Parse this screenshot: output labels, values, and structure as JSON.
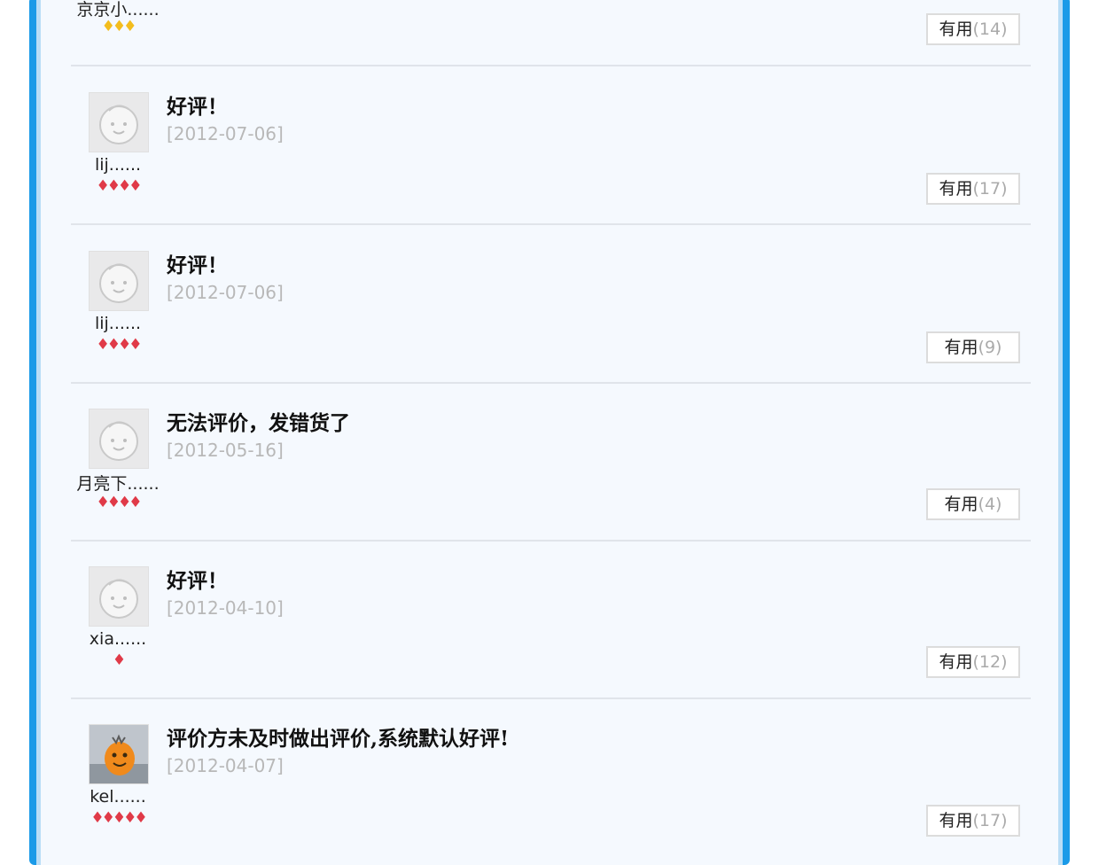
{
  "useful_label": "有用",
  "reviews": [
    {
      "user": "京京小......",
      "rank": "♦♦♦",
      "rank_color": "gold",
      "title": "",
      "date": "",
      "useful_count": "(14)"
    },
    {
      "user": "lij......",
      "rank": "♦♦♦♦",
      "rank_color": "red",
      "title": "好评！",
      "date": "[2012-07-06]",
      "useful_count": "(17)"
    },
    {
      "user": "lij......",
      "rank": "♦♦♦♦",
      "rank_color": "red",
      "title": "好评！",
      "date": "[2012-07-06]",
      "useful_count": "(9)"
    },
    {
      "user": "月亮下......",
      "rank": "♦♦♦♦",
      "rank_color": "red",
      "title": "无法评价，发错货了",
      "date": "[2012-05-16]",
      "useful_count": "(4)"
    },
    {
      "user": "xia......",
      "rank": "♦",
      "rank_color": "red",
      "title": "好评！",
      "date": "[2012-04-10]",
      "useful_count": "(12)"
    },
    {
      "user": "kel......",
      "rank": "♦♦♦♦♦",
      "rank_color": "red",
      "title": "评价方未及时做出评价,系统默认好评!",
      "date": "[2012-04-07]",
      "useful_count": "(17)"
    }
  ]
}
